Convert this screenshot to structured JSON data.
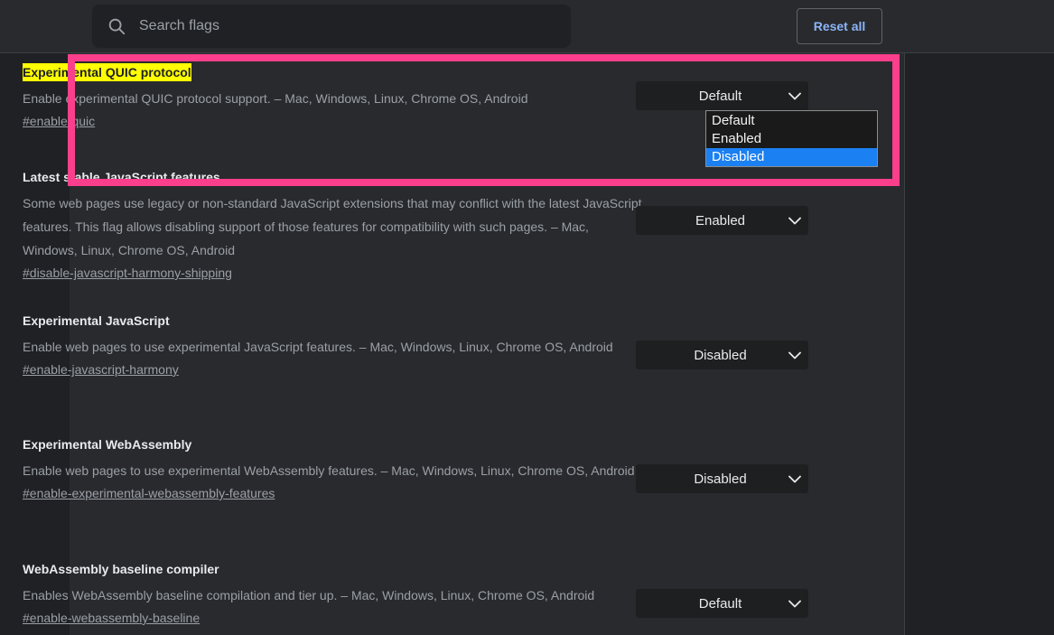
{
  "header": {
    "search": {
      "placeholder": "Search flags",
      "value": "",
      "icon": "search-icon"
    },
    "reset_all_label": "Reset all"
  },
  "colors": {
    "accent_link": "#8ab4f8",
    "highlight_annotation": "#fb3f8c",
    "search_match_highlight": "#ffff00",
    "dropdown_selected": "#1b80f2",
    "page_background": "#202124",
    "card_background": "#292A2D",
    "select_background": "#1e1f20"
  },
  "open_dropdown": {
    "options": [
      "Default",
      "Enabled",
      "Disabled"
    ],
    "selected": "Disabled",
    "belongs_to": "enable-quic"
  },
  "flags": [
    {
      "title": "Experimental QUIC protocol",
      "title_highlighted": true,
      "description": "Enable experimental QUIC protocol support. – Mac, Windows, Linux, Chrome OS, Android",
      "link": "#enable-quic",
      "select_value": "Default",
      "select_open": true
    },
    {
      "title": "Latest stable JavaScript features",
      "title_highlighted": false,
      "description": "Some web pages use legacy or non-standard JavaScript extensions that may conflict with the latest JavaScript features. This flag allows disabling support of those features for compatibility with such pages. – Mac, Windows, Linux, Chrome OS, Android",
      "link": "#disable-javascript-harmony-shipping",
      "select_value": "Enabled",
      "select_open": false
    },
    {
      "title": "Experimental JavaScript",
      "title_highlighted": false,
      "description": "Enable web pages to use experimental JavaScript features. – Mac, Windows, Linux, Chrome OS, Android",
      "link": "#enable-javascript-harmony",
      "select_value": "Disabled",
      "select_open": false
    },
    {
      "title": "Experimental WebAssembly",
      "title_highlighted": false,
      "description": "Enable web pages to use experimental WebAssembly features. – Mac, Windows, Linux, Chrome OS, Android",
      "link": "#enable-experimental-webassembly-features",
      "select_value": "Disabled",
      "select_open": false
    },
    {
      "title": "WebAssembly baseline compiler",
      "title_highlighted": false,
      "description": "Enables WebAssembly baseline compilation and tier up. – Mac, Windows, Linux, Chrome OS, Android",
      "link": "#enable-webassembly-baseline",
      "select_value": "Default",
      "select_open": false
    }
  ]
}
